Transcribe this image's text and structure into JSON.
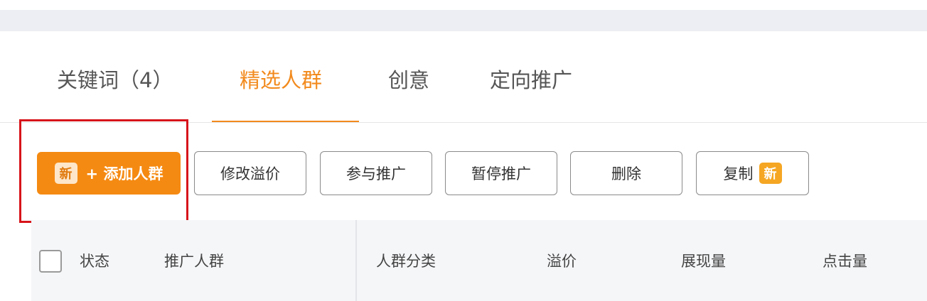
{
  "tabs": [
    {
      "label": "关键词（4）",
      "active": false
    },
    {
      "label": "精选人群",
      "active": true
    },
    {
      "label": "创意",
      "active": false
    },
    {
      "label": "定向推广",
      "active": false
    }
  ],
  "toolbar": {
    "new_badge": "新",
    "add_crowd_label": "+ 添加人群",
    "modify_bid_label": "修改溢价",
    "join_promo_label": "参与推广",
    "pause_promo_label": "暂停推广",
    "delete_label": "删除",
    "copy_label": "复制"
  },
  "table": {
    "columns": [
      "状态",
      "推广人群",
      "人群分类",
      "溢价",
      "展现量",
      "点击量"
    ]
  },
  "colors": {
    "accent": "#f28a1d",
    "primary_button": "#f58a12",
    "highlight_border": "#d7141b"
  }
}
